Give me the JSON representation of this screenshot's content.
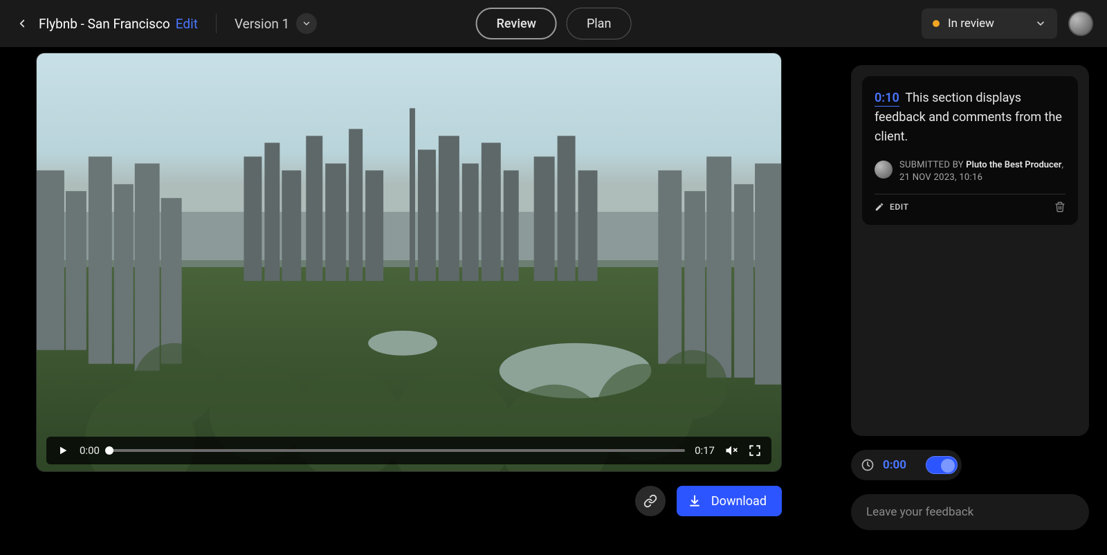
{
  "header": {
    "title": "Flybnb - San Francisco",
    "edit_link": "Edit",
    "version_label": "Version 1",
    "tabs": {
      "review": "Review",
      "plan": "Plan"
    },
    "status_label": "In review",
    "status_color": "#f5a623"
  },
  "video": {
    "current_time": "0:00",
    "duration": "0:17"
  },
  "actions": {
    "download_label": "Download"
  },
  "comments": [
    {
      "timestamp": "0:10",
      "text": "This section displays feedback and comments from the client.",
      "submitted_by_label": "SUBMITTED BY",
      "author": "Pluto the Best Producer",
      "date": "21 NOV 2023, 10:16",
      "edit_label": "EDIT"
    }
  ],
  "feedback": {
    "time_value": "0:00",
    "placeholder": "Leave your feedback"
  }
}
